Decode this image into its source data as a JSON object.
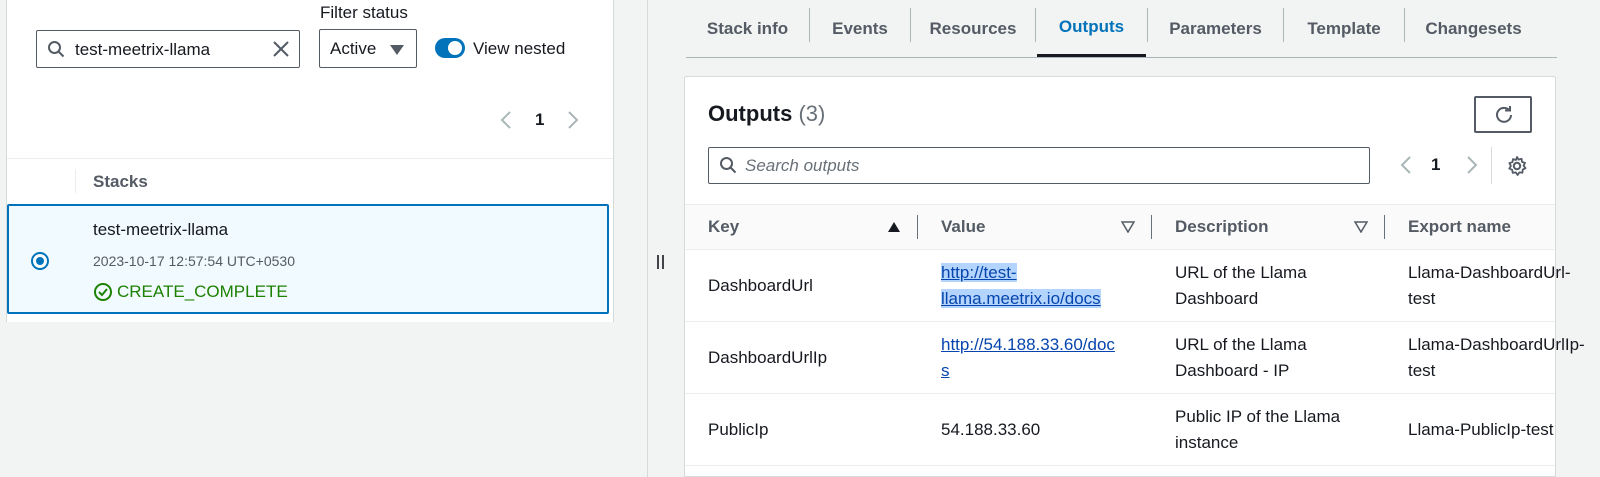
{
  "left": {
    "filter_status_label": "Filter status",
    "search_value": "test-meetrix-llama",
    "status_select_value": "Active",
    "view_nested_label": "View nested",
    "page_number": "1",
    "stacks_column": "Stacks",
    "stack": {
      "name": "test-meetrix-llama",
      "date": "2023-10-17 12:57:54 UTC+0530",
      "status": "CREATE_COMPLETE"
    }
  },
  "tabs": [
    {
      "label": "Stack info"
    },
    {
      "label": "Events"
    },
    {
      "label": "Resources"
    },
    {
      "label": "Outputs"
    },
    {
      "label": "Parameters"
    },
    {
      "label": "Template"
    },
    {
      "label": "Changesets"
    }
  ],
  "outputs": {
    "title": "Outputs",
    "count": "(3)",
    "search_placeholder": "Search outputs",
    "page_number": "1",
    "columns": {
      "key": "Key",
      "value": "Value",
      "description": "Description",
      "export": "Export name"
    },
    "rows": [
      {
        "key": "DashboardUrl",
        "value_line1": "http://test-",
        "value_line2": "llama.meetrix.io/docs",
        "desc_line1": "URL of the Llama",
        "desc_line2": "Dashboard",
        "export_line1": "Llama-DashboardUrl-",
        "export_line2": "test"
      },
      {
        "key": "DashboardUrlIp",
        "value_line1": "http://54.188.33.60/doc",
        "value_line2": "s",
        "desc_line1": "URL of the Llama",
        "desc_line2": "Dashboard - IP",
        "export_line1": "Llama-DashboardUrlIp-",
        "export_line2": "test"
      },
      {
        "key": "PublicIp",
        "value_line1": "54.188.33.60",
        "desc_line1": "Public IP of the Llama",
        "desc_line2": "instance",
        "export_line1": "Llama-PublicIp-test"
      }
    ]
  },
  "colors": {
    "accent": "#0073bb",
    "success": "#1d8102",
    "link": "#0645ad"
  }
}
